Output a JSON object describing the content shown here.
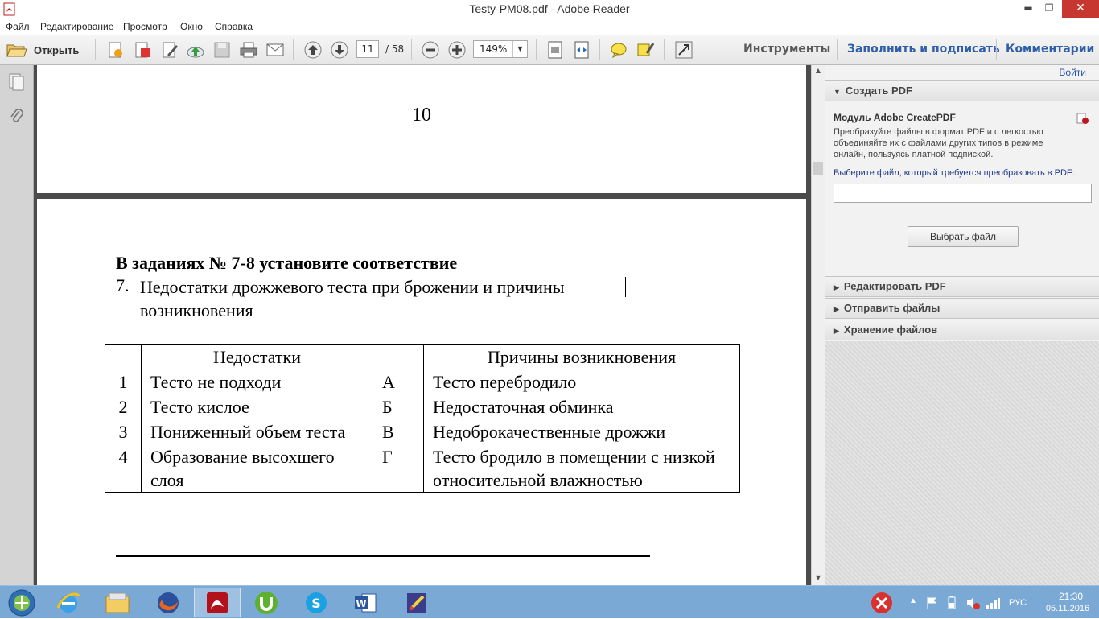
{
  "window": {
    "title": "Testy-PM08.pdf - Adobe Reader",
    "minimize_glyph": "▬",
    "restore_glyph": "❐",
    "close_glyph": "✕"
  },
  "menu": {
    "items": [
      "Файл",
      "Редактирование",
      "Просмотр",
      "Окно",
      "Справка"
    ]
  },
  "toolbar": {
    "open_label": "Открыть",
    "page_current": "11",
    "page_total": "/ 58",
    "zoom": "149%",
    "zoom_arrow": "▼",
    "tools_link": "Инструменты",
    "sign_link": "Заполнить и подписать",
    "comments_link": "Комментарии"
  },
  "document": {
    "prev_page_number": "10",
    "heading": "В заданиях № 7-8 установите соответствие",
    "question_number": "7.",
    "question_text": "Недостатки дрожжевого теста при брожении и причины возникновения",
    "table": {
      "header": [
        "",
        "Недостатки",
        "",
        "Причины возникновения"
      ],
      "rows": [
        [
          "1",
          "Тесто не подходи",
          "А",
          "Тесто перебродило"
        ],
        [
          "2",
          "Тесто кислое",
          "Б",
          "Недостаточная обминка"
        ],
        [
          "3",
          "Пониженный объем теста",
          "В",
          "Недоброкачественные дрожжи"
        ],
        [
          "4",
          "Образование высохшего слоя",
          "Г",
          "Тесто бродило в помещении с низкой относительной влажностью"
        ]
      ]
    }
  },
  "right_pane": {
    "login_link": "Войти",
    "create_pdf": {
      "header": "Создать PDF",
      "module_title": "Модуль Adobe CreatePDF",
      "description": "Преобразуйте файлы в формат PDF и с легкостью объединяйте их с файлами других типов в режиме онлайн, пользуясь платной подпиской.",
      "prompt": "Выберите файл, который требуется преобразовать в PDF:",
      "input_value": "",
      "choose_button": "Выбрать файл"
    },
    "collapsed_panels": [
      "Редактировать PDF",
      "Отправить файлы",
      "Хранение файлов"
    ]
  },
  "taskbar": {
    "apps": [
      "start-orb",
      "internet-explorer",
      "file-explorer",
      "firefox",
      "adobe-reader",
      "utorrent",
      "skype",
      "word",
      "paint"
    ],
    "language": "РУС",
    "time": "21:30",
    "date": "05.11.2016"
  },
  "colors": {
    "accent_link": "#2a56a8",
    "close_button": "#c7372f",
    "taskbar": "#7ba9d6",
    "document_background": "#4b4b4b"
  }
}
